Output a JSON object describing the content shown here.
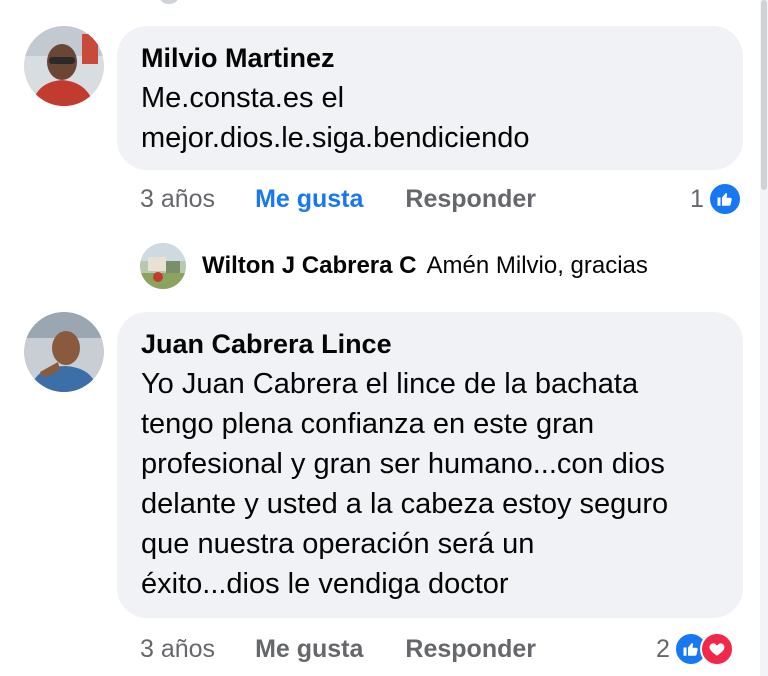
{
  "comments": [
    {
      "author": "Milvio Martinez",
      "text": "Me.consta.es el\nmejor.dios.le.siga.bendiciendo",
      "age": "3 años",
      "like_label": "Me gusta",
      "reply_label": "Responder",
      "reaction_count": "1",
      "reactions": [
        "like-icon"
      ],
      "liked": true
    },
    {
      "author": "Juan Cabrera Lince",
      "text": "Yo Juan Cabrera el lince de la bachata\ntengo plena confianza en este gran\nprofesional y gran ser humano...con dios\ndelante y usted a la cabeza estoy seguro\nque nuestra operación será un\néxito...dios le vendiga doctor",
      "age": "3 años",
      "like_label": "Me gusta",
      "reply_label": "Responder",
      "reaction_count": "2",
      "reactions": [
        "like-icon",
        "love-icon"
      ],
      "liked": false
    }
  ],
  "reply_preview": {
    "author": "Wilton J Cabrera C",
    "text": "Amén Milvio, gracias"
  },
  "colors": {
    "bubble": "#f0f2f5",
    "link_blue": "#1877f2",
    "meta_gray": "#65676b",
    "love_red": "#f0284a"
  }
}
